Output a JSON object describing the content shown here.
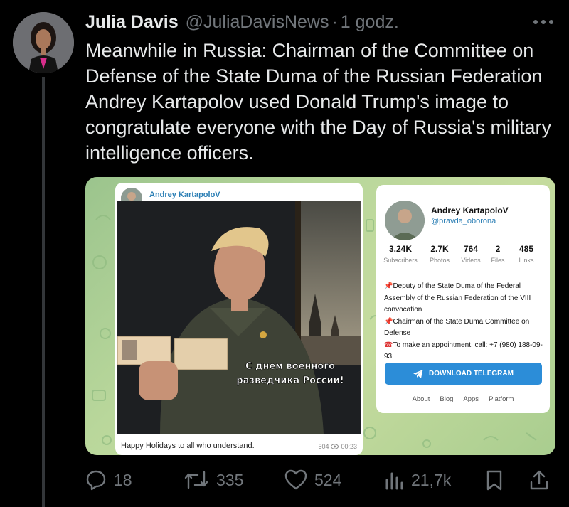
{
  "tweet": {
    "author_name": "Julia Davis",
    "author_handle": "@JuliaDavisNews",
    "separator": "·",
    "time": "1 godz.",
    "text": "Meanwhile in Russia: Chairman of the Committee on Defense of the State Duma of the Russian Federation Andrey Kartapolov used Donald Trump's image to congratulate everyone with the Day of Russia's military intelligence officers."
  },
  "media": {
    "post": {
      "channel_title": "Andrey KartapoloV",
      "overlay_line1": "С днем военного",
      "overlay_line2": "разведчика России!",
      "caption": "Happy Holidays to all who understand.",
      "views": "504",
      "time": "00:23"
    },
    "channel": {
      "name": "Andrey KartapoloV",
      "handle": "@pravda_oborona",
      "stats": [
        {
          "value": "3.24K",
          "label": "Subscribers"
        },
        {
          "value": "2.7K",
          "label": "Photos"
        },
        {
          "value": "764",
          "label": "Videos"
        },
        {
          "value": "2",
          "label": "Files"
        },
        {
          "value": "485",
          "label": "Links"
        }
      ],
      "bio": [
        {
          "icon": "📌",
          "text": "Deputy of the State Duma of the Federal Assembly of the Russian Federation of the VIII convocation"
        },
        {
          "icon": "📌",
          "text": "Chairman of the State Duma Committee on Defense"
        },
        {
          "icon": "☎",
          "text": "To make an appointment, call: +7 (980) 188-09-93"
        }
      ],
      "button_label": "DOWNLOAD TELEGRAM",
      "links": [
        "About",
        "Blog",
        "Apps",
        "Platform"
      ]
    }
  },
  "actions": {
    "replies": "18",
    "reposts": "335",
    "likes": "524",
    "views": "21,7k"
  },
  "colors": {
    "background": "#000000",
    "text_primary": "#e7e9ea",
    "text_secondary": "#71767b",
    "telegram_blue": "#2c8dd8"
  }
}
